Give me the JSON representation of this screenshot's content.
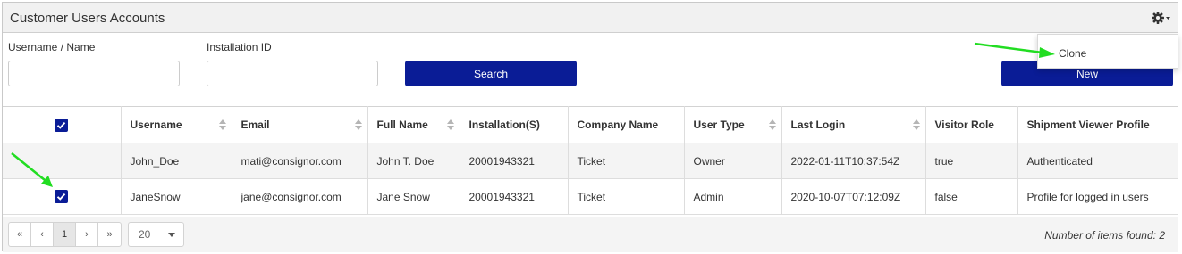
{
  "header": {
    "title": "Customer Users Accounts",
    "settings_icon": "gear-icon"
  },
  "filters": {
    "username_label": "Username / Name",
    "username_value": "",
    "installation_label": "Installation ID",
    "installation_value": "",
    "search_label": "Search",
    "new_label": "New"
  },
  "dropdown": {
    "items": [
      "Clone"
    ]
  },
  "table": {
    "columns": [
      "",
      "Username",
      "Email",
      "Full Name",
      "Installation(S)",
      "Company Name",
      "User Type",
      "Last Login",
      "Visitor Role",
      "Shipment Viewer Profile"
    ],
    "sortable": [
      false,
      true,
      true,
      true,
      false,
      false,
      true,
      true,
      false,
      false
    ],
    "header_checked": true,
    "rows": [
      {
        "checked": false,
        "cells": [
          "John_Doe",
          "mati@consignor.com",
          "John T. Doe",
          "20001943321",
          "Ticket",
          "Owner",
          "2022-01-11T10:37:54Z",
          "true",
          "Authenticated"
        ]
      },
      {
        "checked": true,
        "cells": [
          "JaneSnow",
          "jane@consignor.com",
          "Jane Snow",
          "20001943321",
          "Ticket",
          "Admin",
          "2020-10-07T07:12:09Z",
          "false",
          "Profile for logged in users"
        ]
      }
    ]
  },
  "pagination": {
    "first": "«",
    "prev": "‹",
    "current": "1",
    "next": "›",
    "last": "»",
    "page_size": "20",
    "items_found": "Number of items found: 2"
  },
  "colors": {
    "primary": "#0a1c96",
    "annotation_arrow": "#22dd22"
  }
}
